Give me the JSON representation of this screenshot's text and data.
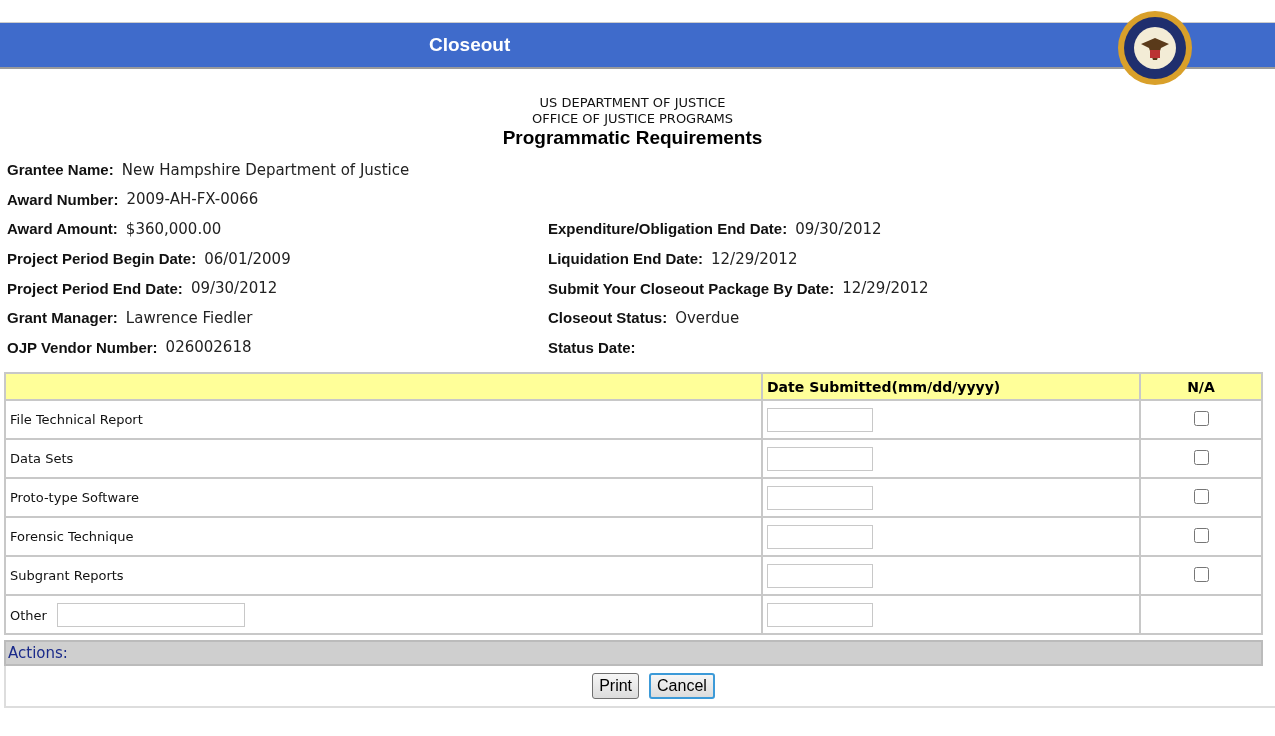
{
  "header": {
    "title": "Closeout"
  },
  "heading": {
    "line_1": "US DEPARTMENT OF JUSTICE",
    "line_2": "OFFICE OF JUSTICE PROGRAMS",
    "title": "Programmatic Requirements"
  },
  "details": [
    {
      "left": {
        "label": "Grantee Name:",
        "value": "New Hampshire Department of Justice"
      }
    },
    {
      "left": {
        "label": "Award Number:",
        "value": "2009-AH-FX-0066"
      }
    },
    {
      "left": {
        "label": "Award Amount:",
        "value": "$360,000.00"
      },
      "right": {
        "label": "Expenditure/Obligation End Date:",
        "value": "09/30/2012"
      }
    },
    {
      "left": {
        "label": "Project Period Begin Date:",
        "value": "06/01/2009"
      },
      "right": {
        "label": "Liquidation End Date:",
        "value": "12/29/2012"
      }
    },
    {
      "left": {
        "label": "Project Period End Date:",
        "value": "09/30/2012"
      },
      "right": {
        "label": "Submit Your Closeout Package By Date:",
        "value": "12/29/2012"
      }
    },
    {
      "left": {
        "label": "Grant Manager:",
        "value": "Lawrence Fiedler"
      },
      "right": {
        "label": "Closeout Status:",
        "value": "Overdue"
      }
    },
    {
      "left": {
        "label": "OJP Vendor Number:",
        "value": "026002618"
      },
      "right": {
        "label": "Status Date:"
      }
    }
  ],
  "table": {
    "columns": [
      "Date Submitted(mm/dd/yyyy)",
      "N/A"
    ],
    "rows": [
      {
        "kind": "checkbox",
        "label": "File Technical Report",
        "checked": false
      },
      {
        "kind": "checkbox",
        "label": "Data Sets",
        "checked": false
      },
      {
        "kind": "checkbox",
        "label": "Proto-type Software",
        "checked": false
      },
      {
        "kind": "checkbox",
        "label": "Forensic Technique",
        "checked": false
      },
      {
        "kind": "checkbox",
        "label": "Subgrant Reports",
        "checked": false
      },
      {
        "kind": "other",
        "label": "Other"
      }
    ]
  },
  "actions": {
    "title": "Actions:",
    "buttons": [
      {
        "label": "Print",
        "focused": false
      },
      {
        "label": "Cancel",
        "focused": true
      }
    ]
  }
}
